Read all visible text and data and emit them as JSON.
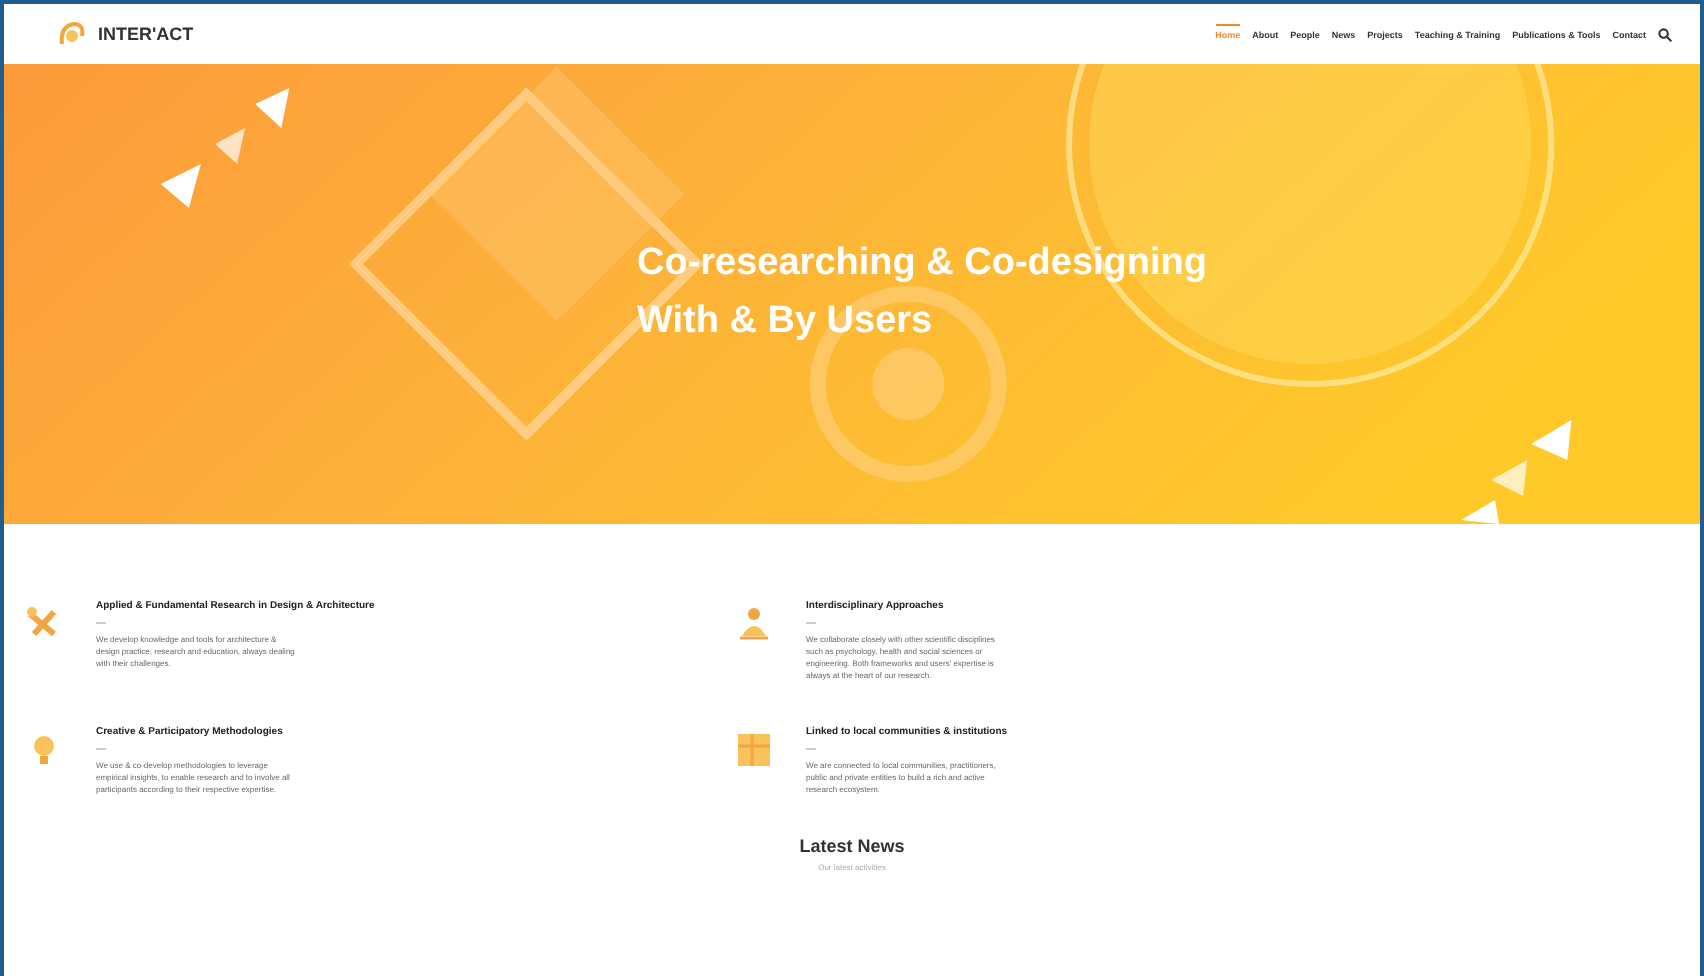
{
  "header": {
    "logo": "INTER'ACT",
    "nav": [
      {
        "label": "Home",
        "selected": true
      },
      {
        "label": "About",
        "selected": false
      },
      {
        "label": "People",
        "selected": false
      },
      {
        "label": "News",
        "selected": false
      },
      {
        "label": "Projects",
        "selected": false
      },
      {
        "label": "Teaching & Training",
        "selected": false
      },
      {
        "label": "Publications & Tools",
        "selected": false
      },
      {
        "label": "Contact",
        "selected": false
      }
    ]
  },
  "hero": {
    "title_line_1": "Co-researching & Co-designing",
    "title_line_2": "With & By Users"
  },
  "features": [
    {
      "kind": "tools",
      "title": "Applied & Fundamental Research in Design & Architecture",
      "text": "We develop knowledge and tools for architecture & design practice, research and education, always dealing with their challenges."
    },
    {
      "kind": "people",
      "title": "Interdisciplinary Approaches",
      "text": "We collaborate closely with other scientific disciplines such as psychology, health and social sciences or engineering. Both frameworks and users' expertise is always at the heart of our research."
    },
    {
      "kind": "bulb",
      "title": "Creative & Participatory Methodologies",
      "text": "We use & co-develop methodologies to leverage empirical insights, to enable research and to involve all participants according to their respective expertise."
    },
    {
      "kind": "map",
      "title": "Linked to local communities & institutions",
      "text": "We are connected to local communities, practitioners, public and private entities to build a rich and active research ecosystem."
    }
  ],
  "news": {
    "title": "Latest News",
    "subtitle": "Our latest activities"
  }
}
